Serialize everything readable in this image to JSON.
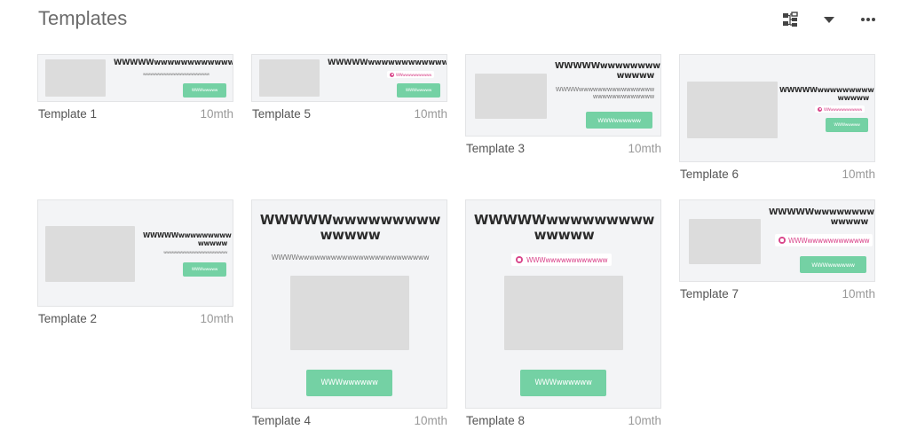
{
  "header": {
    "title": "Templates",
    "icons": [
      "sitemap-icon",
      "caret-down-icon",
      "more-icon"
    ]
  },
  "templates": {
    "t1": {
      "name": "Template 1",
      "age": "10mth",
      "headline": "WWWWWwwwwwwwwwwwww",
      "sub": "wwwwwwwwwwwwwwwwwwwwwwwwww",
      "button": "WWWwwwww"
    },
    "t2": {
      "name": "Template 2",
      "age": "10mth",
      "headline1": "WWWWWwwwwwwwww",
      "headline2": "wwwww",
      "sub": "wwwwwwwwwwwwwwwwwwwwwwwww",
      "button": "WWWwwwww"
    },
    "t3": {
      "name": "Template 3",
      "age": "10mth",
      "headline1": "WWWWWwwwwwwww",
      "headline2": "wwwww",
      "sub1": "WWWWwwwwwwwwwwwwwwww",
      "sub2": "wwwwwwwwwwwww",
      "button": "WWWwwwwww"
    },
    "t4": {
      "name": "Template 4",
      "age": "10mth",
      "headline1": "WWWWWwwwwwwwww",
      "headline2": "wwwww",
      "sub": "WWWWwwwwwwwwwwwwwwwwwwwwwwww",
      "button": "WWWwwwwww"
    },
    "t5": {
      "name": "Template 5",
      "age": "10mth",
      "headline": "WWWWWwwwwwwwwwwwww",
      "pill": "WWwwwwwwwwwww",
      "button": "WWWwwwww"
    },
    "t6": {
      "name": "Template 6",
      "age": "10mth",
      "headline1": "WWWWWwwwwwwwww",
      "headline2": "wwwww",
      "pill": "WWwwwwwwwwwwww",
      "button": "WWWwwwww"
    },
    "t7": {
      "name": "Template 7",
      "age": "10mth",
      "headline1": "WWWWWwwwwwwwww",
      "headline2": "wwwww",
      "pill": "WWWwwwwwwwwwwww",
      "button": "WWWwwwwww"
    },
    "t8": {
      "name": "Template 8",
      "age": "10mth",
      "headline1": "WWWWWwwwwwwwww",
      "headline2": "wwwww",
      "pill": "WWWwwwwwwwwwwww",
      "button": "WWWwwwwww"
    }
  }
}
